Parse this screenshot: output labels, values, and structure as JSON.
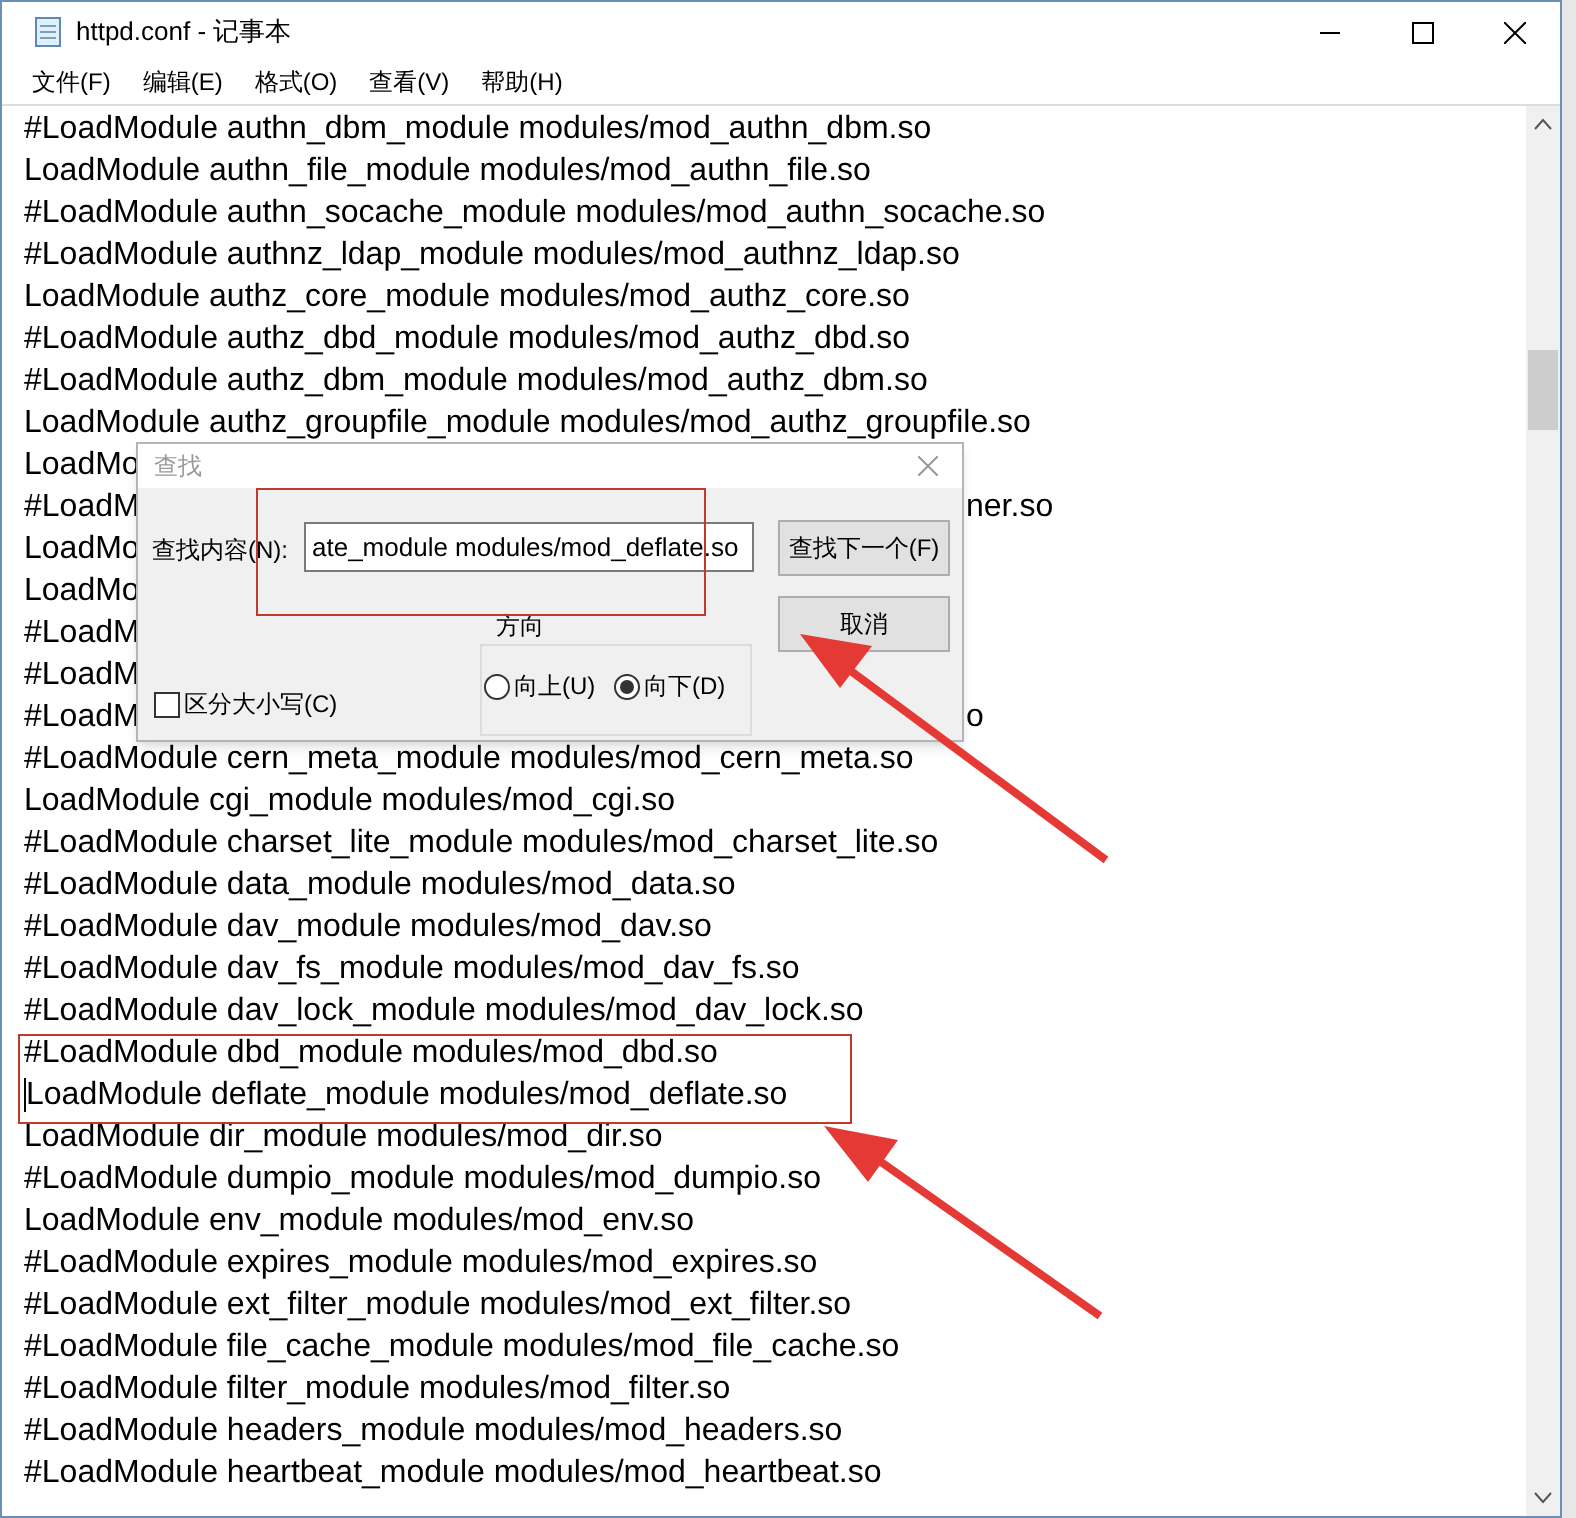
{
  "window": {
    "title": "httpd.conf - 记事本"
  },
  "menu": [
    "文件(F)",
    "编辑(E)",
    "格式(O)",
    "查看(V)",
    "帮助(H)"
  ],
  "editor": {
    "lines": [
      {
        "text": "#LoadModule authn_dbm_module modules/mod_authn_dbm.so"
      },
      {
        "text": "LoadModule authn_file_module modules/mod_authn_file.so"
      },
      {
        "text": "#LoadModule authn_socache_module modules/mod_authn_socache.so"
      },
      {
        "text": "#LoadModule authnz_ldap_module modules/mod_authnz_ldap.so"
      },
      {
        "text": "LoadModule authz_core_module modules/mod_authz_core.so"
      },
      {
        "text": "#LoadModule authz_dbd_module modules/mod_authz_dbd.so"
      },
      {
        "text": "#LoadModule authz_dbm_module modules/mod_authz_dbm.so"
      },
      {
        "text": "LoadModule authz_groupfile_module modules/mod_authz_groupfile.so"
      },
      {
        "left": "LoadMo"
      },
      {
        "left": "#LoadM",
        "right": "ner.so"
      },
      {
        "left": "LoadMo"
      },
      {
        "left": "LoadMo"
      },
      {
        "left": "#LoadM"
      },
      {
        "left": "#LoadM"
      },
      {
        "left": "#LoadM",
        "right": "o"
      },
      {
        "text": "#LoadModule cern_meta_module modules/mod_cern_meta.so"
      },
      {
        "text": "LoadModule cgi_module modules/mod_cgi.so"
      },
      {
        "text": "#LoadModule charset_lite_module modules/mod_charset_lite.so"
      },
      {
        "text": "#LoadModule data_module modules/mod_data.so"
      },
      {
        "text": "#LoadModule dav_module modules/mod_dav.so"
      },
      {
        "text": "#LoadModule dav_fs_module modules/mod_dav_fs.so"
      },
      {
        "text": "#LoadModule dav_lock_module modules/mod_dav_lock.so"
      },
      {
        "text": "#LoadModule dbd_module modules/mod_dbd.so"
      },
      {
        "text": "LoadModule deflate_module modules/mod_deflate.so",
        "caret": true
      },
      {
        "text": "LoadModule dir_module modules/mod_dir.so"
      },
      {
        "text": "#LoadModule dumpio_module modules/mod_dumpio.so"
      },
      {
        "text": "LoadModule env_module modules/mod_env.so"
      },
      {
        "text": "#LoadModule expires_module modules/mod_expires.so"
      },
      {
        "text": "#LoadModule ext_filter_module modules/mod_ext_filter.so"
      },
      {
        "text": "#LoadModule file_cache_module modules/mod_file_cache.so"
      },
      {
        "text": "#LoadModule filter_module modules/mod_filter.so"
      },
      {
        "text": "#LoadModule headers_module modules/mod_headers.so"
      },
      {
        "text": "#LoadModule heartbeat_module modules/mod_heartbeat.so"
      }
    ]
  },
  "find_dialog": {
    "title": "查找",
    "find_label": "查找内容(N):",
    "find_value": "ate_module modules/mod_deflate.so",
    "find_next_button": "查找下一个(F)",
    "cancel_button": "取消",
    "direction_label": "方向",
    "directions": [
      {
        "label": "向上(U)",
        "selected": false
      },
      {
        "label": "向下(D)",
        "selected": true
      }
    ],
    "match_case": {
      "label": "区分大小写(C)",
      "checked": false
    }
  }
}
